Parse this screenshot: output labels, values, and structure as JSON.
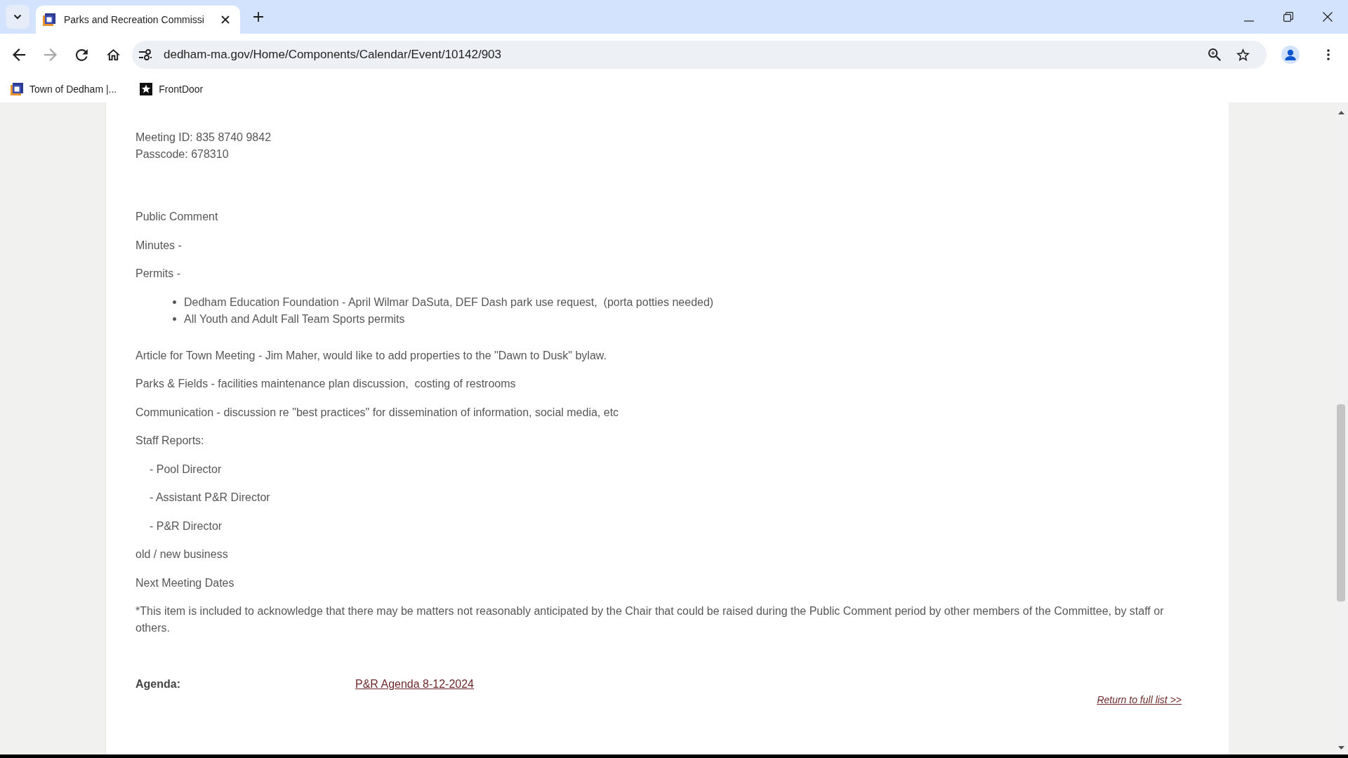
{
  "browser": {
    "tabs": [
      {
        "title": "Parks and Recreation Commissi",
        "selected": true
      }
    ],
    "address": "dedham-ma.gov/Home/Components/Calendar/Event/10142/903",
    "bookmarks": [
      {
        "kind": "logo",
        "label": "Town of Dedham |..."
      },
      {
        "kind": "star",
        "label": "FrontDoor"
      }
    ]
  },
  "page": {
    "meeting_info": [
      "Meeting ID: 835 8740 9842",
      "Passcode: 678310"
    ],
    "agenda_items": [
      {
        "kind": "paragraph",
        "text": "Public Comment"
      },
      {
        "kind": "paragraph",
        "text": "Minutes -"
      },
      {
        "kind": "paragraph",
        "text": "Permits -"
      },
      {
        "kind": "bullets",
        "items": [
          "Dedham Education Foundation - April Wilmar DaSuta, DEF Dash park use request,  (porta potties needed)",
          "All Youth and Adult Fall Team Sports permits"
        ]
      },
      {
        "kind": "paragraph",
        "text": "Article for Town Meeting - Jim Maher, would like to add properties to the \"Dawn to Dusk\" bylaw."
      },
      {
        "kind": "paragraph",
        "text": "Parks & Fields - facilities maintenance plan discussion,  costing of restrooms"
      },
      {
        "kind": "paragraph",
        "text": "Communication - discussion re \"best practices\" for dissemination of information, social media, etc"
      },
      {
        "kind": "paragraph",
        "text": "Staff Reports:"
      },
      {
        "kind": "indented",
        "text": "- Pool Director"
      },
      {
        "kind": "indented",
        "text": "- Assistant P&R Director"
      },
      {
        "kind": "indented",
        "text": "- P&R Director"
      },
      {
        "kind": "paragraph",
        "text": "old / new business"
      },
      {
        "kind": "paragraph",
        "text": "Next Meeting Dates"
      }
    ],
    "footnote": "*This item is included to acknowledge that there may be matters not reasonably anticipated by the Chair that could be raised during the Public Comment period by other members of the Committee, by staff or others.",
    "agenda": {
      "label": "Agenda:",
      "link": "P&R Agenda 8-12-2024"
    },
    "return_link": "Return to full list >>"
  }
}
